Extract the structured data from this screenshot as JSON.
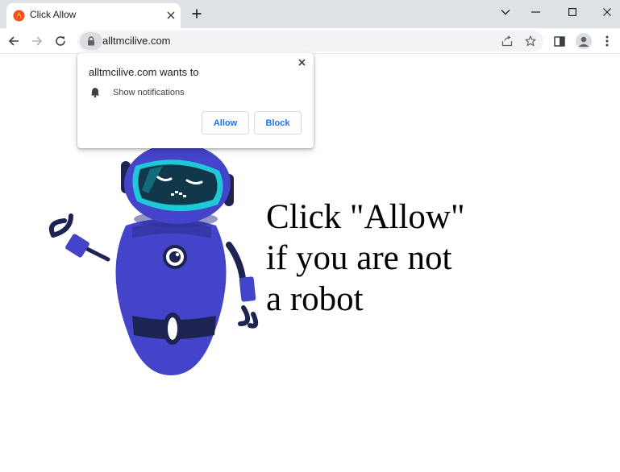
{
  "tab": {
    "title": "Click Allow"
  },
  "toolbar": {
    "url": "alltmcilive.com"
  },
  "permission_prompt": {
    "title": "alltmcilive.com wants to",
    "permission": "Show notifications",
    "allow_label": "Allow",
    "block_label": "Block"
  },
  "page": {
    "headline": [
      "Click \"Allow\"",
      "if you are not",
      "a robot"
    ]
  },
  "colors": {
    "robot_body": "#4344c9",
    "robot_dark": "#1e2452",
    "robot_visor": "#1ec8d8",
    "button_text": "#1a73e8"
  }
}
